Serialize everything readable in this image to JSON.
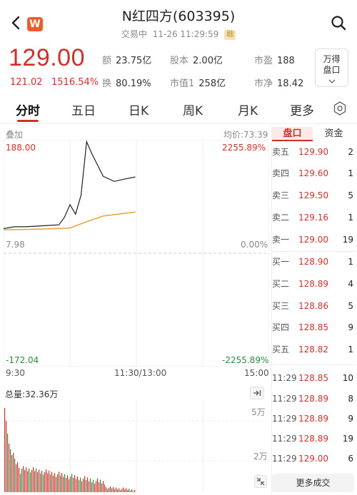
{
  "header": {
    "title": "N红四方(603395)",
    "status": "交易中",
    "datetime": "11-26 11:29:59",
    "badge": "融",
    "app_badge": "W",
    "icons": [
      "back-icon",
      "search-icon",
      "settings-icon",
      "expand-icon",
      "collapse-icon"
    ]
  },
  "quote": {
    "price": "129.00",
    "change": "121.02",
    "change_pct": "1516.54%",
    "stats": [
      {
        "label": "额",
        "value": "23.75亿"
      },
      {
        "label": "股本",
        "value": "2.00亿"
      },
      {
        "label": "市盈",
        "value": "188"
      },
      {
        "label": "换",
        "value": "80.19%"
      },
      {
        "label": "市值1",
        "value": "258亿"
      },
      {
        "label": "市净",
        "value": "18.42"
      }
    ],
    "panel_button": "万得\n盘口"
  },
  "tabs": [
    "分时",
    "五日",
    "日K",
    "周K",
    "月K",
    "更多"
  ],
  "chart": {
    "overlay_label": "叠加",
    "avg_label": "均价:73.39",
    "y_top": "188.00",
    "y_top_pct": "2255.89%",
    "y_mid": "7.98",
    "y_mid_pct": "0.00%",
    "y_bottom": "-172.04",
    "y_bottom_pct": "-2255.89%",
    "x_labels": [
      "9:30",
      "11:30/13:00",
      "15:00"
    ],
    "volume_label": "总量:32.36万",
    "vol_tick_top": "5万",
    "vol_tick_mid": "2万",
    "colors": {
      "price": "#222222",
      "avg": "#e8a13a",
      "up": "#d0302c",
      "down": "#2a8a3e"
    }
  },
  "chart_data": {
    "type": "line",
    "title": "",
    "x_range": [
      "9:30",
      "15:00"
    ],
    "ylim": [
      -172.04,
      188.0
    ],
    "series": [
      {
        "values_note": "",
        "x": [
          "9:30",
          "9:40",
          "9:50",
          "10:00",
          "10:10",
          "10:20",
          "10:25",
          "10:30",
          "10:35",
          "10:40",
          "10:45",
          "10:50",
          "11:00",
          "11:10",
          "11:20",
          "11:29"
        ],
        "values": [
          47,
          50,
          50,
          51,
          52,
          53,
          65,
          85,
          70,
          100,
          185,
          165,
          130,
          122,
          126,
          129
        ]
      },
      {
        "x": [
          "9:30",
          "10:00",
          "10:30",
          "10:45",
          "11:00",
          "11:29"
        ],
        "values": [
          45,
          46,
          48,
          58,
          67,
          73.39
        ]
      }
    ]
  },
  "orderbook": {
    "tabs": [
      "盘口",
      "资金"
    ],
    "asks": [
      {
        "label": "卖五",
        "price": "129.90",
        "vol": "2"
      },
      {
        "label": "卖四",
        "price": "129.60",
        "vol": "1"
      },
      {
        "label": "卖三",
        "price": "129.50",
        "vol": "5"
      },
      {
        "label": "卖二",
        "price": "129.16",
        "vol": "1"
      },
      {
        "label": "卖一",
        "price": "129.00",
        "vol": "19"
      }
    ],
    "bids": [
      {
        "label": "买一",
        "price": "128.90",
        "vol": "1"
      },
      {
        "label": "买二",
        "price": "128.89",
        "vol": "4"
      },
      {
        "label": "买三",
        "price": "128.86",
        "vol": "5"
      },
      {
        "label": "买四",
        "price": "128.85",
        "vol": "9"
      },
      {
        "label": "买五",
        "price": "128.82",
        "vol": "1"
      }
    ],
    "trades": [
      {
        "time": "11:29",
        "price": "128.85",
        "vol": "10"
      },
      {
        "time": "11:29",
        "price": "128.89",
        "vol": "8"
      },
      {
        "time": "11:29",
        "price": "128.89",
        "vol": "9"
      },
      {
        "time": "11:29",
        "price": "128.89",
        "vol": "19"
      },
      {
        "time": "11:29",
        "price": "129.00",
        "vol": "6"
      }
    ],
    "more_trades": "更多成交"
  }
}
